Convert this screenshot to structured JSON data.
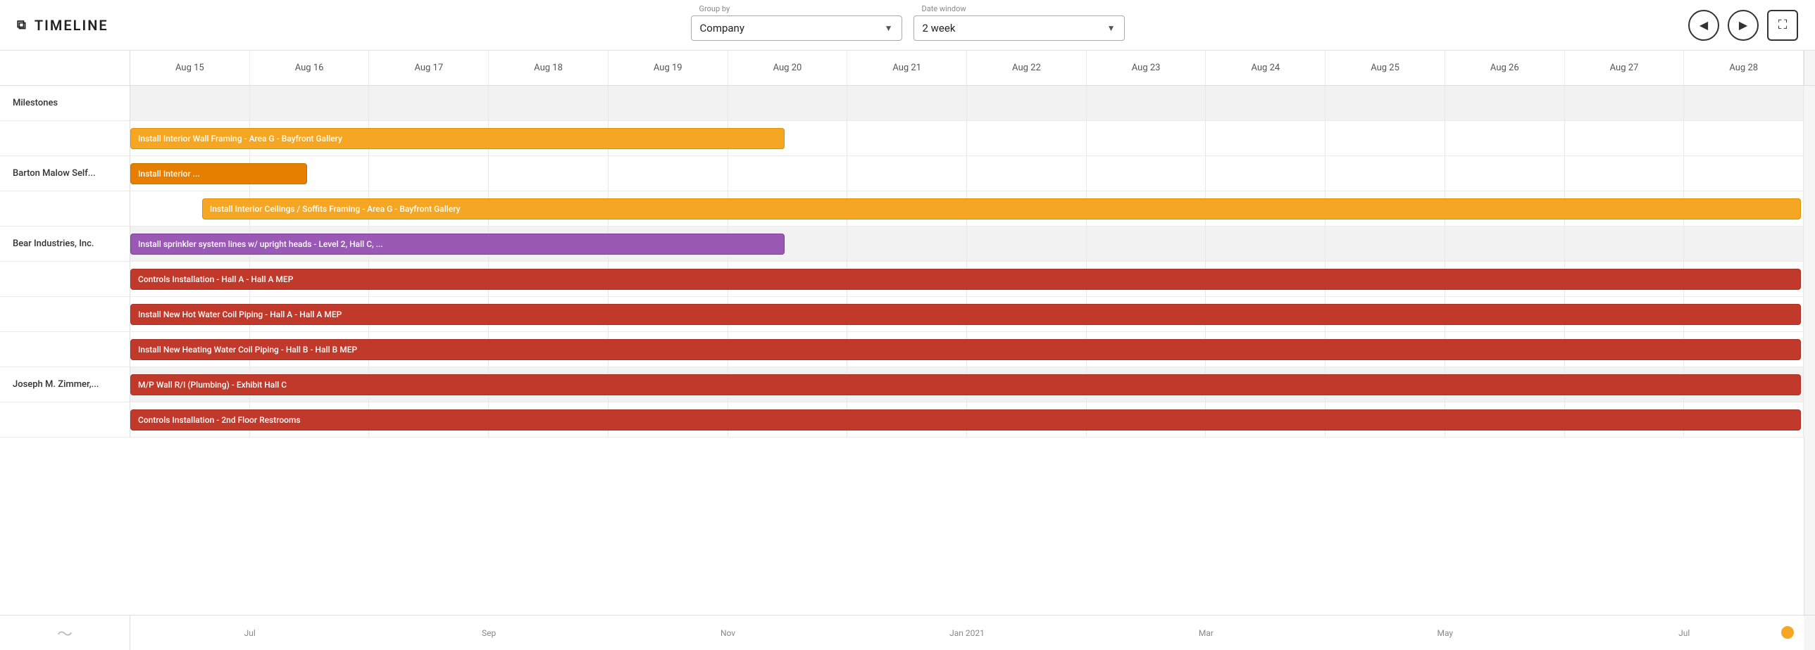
{
  "header": {
    "title": "TIMELINE",
    "group_by_label": "Group by",
    "group_by_value": "Company",
    "date_window_label": "Date window",
    "date_window_value": "2 week",
    "nav_left": "◀",
    "nav_right": "▶",
    "expand": "⤢"
  },
  "dates": [
    "Aug 15",
    "Aug 16",
    "Aug 17",
    "Aug 18",
    "Aug 19",
    "Aug 20",
    "Aug 21",
    "Aug 22",
    "Aug 23",
    "Aug 24",
    "Aug 25",
    "Aug 26",
    "Aug 27",
    "Aug 28"
  ],
  "bottom_dates": [
    "Jul",
    "Sep",
    "Nov",
    "Jan 2021",
    "Mar",
    "May",
    "Jul"
  ],
  "rows": [
    {
      "label": "Milestones",
      "tasks": []
    },
    {
      "label": "",
      "tasks": [
        {
          "text": "Install Interior Wall Framing - Area G - Bayfront Gallery",
          "color": "orange",
          "start_col": 0,
          "span_cols": 5.5
        }
      ]
    },
    {
      "label": "Barton Malow Self...",
      "tasks": [
        {
          "text": "Install Interior ...",
          "color": "orange-dark",
          "start_col": 0,
          "span_cols": 1.5
        }
      ]
    },
    {
      "label": "",
      "tasks": [
        {
          "text": "Install Interior Ceilings / Soffits Framing - Area G - Bayfront Gallery",
          "color": "orange",
          "start_col": 0.6,
          "span_cols": 13.4
        }
      ]
    },
    {
      "label": "Bear Industries, Inc.",
      "tasks": [
        {
          "text": "Install sprinkler system lines w/ upright heads - Level 2, Hall C, ...",
          "color": "purple",
          "start_col": 0,
          "span_cols": 5.5
        }
      ]
    },
    {
      "label": "",
      "tasks": [
        {
          "text": "Controls Installation - Hall A - Hall A MEP",
          "color": "red",
          "start_col": 0,
          "span_cols": 14
        }
      ]
    },
    {
      "label": "",
      "tasks": [
        {
          "text": "Install New Hot Water Coil Piping - Hall A - Hall A MEP",
          "color": "red",
          "start_col": 0,
          "span_cols": 14
        }
      ]
    },
    {
      "label": "",
      "tasks": [
        {
          "text": "Install New Heating Water Coil Piping - Hall B - Hall B MEP",
          "color": "red",
          "start_col": 0,
          "span_cols": 14
        }
      ]
    },
    {
      "label": "Joseph M. Zimmer,...",
      "tasks": [
        {
          "text": "M/P Wall R/I (Plumbing) - Exhibit Hall C",
          "color": "red",
          "start_col": 0,
          "span_cols": 14
        }
      ]
    },
    {
      "label": "",
      "tasks": [
        {
          "text": "Controls Installation - 2nd Floor Restrooms",
          "color": "red",
          "start_col": 0,
          "span_cols": 14
        }
      ]
    }
  ]
}
